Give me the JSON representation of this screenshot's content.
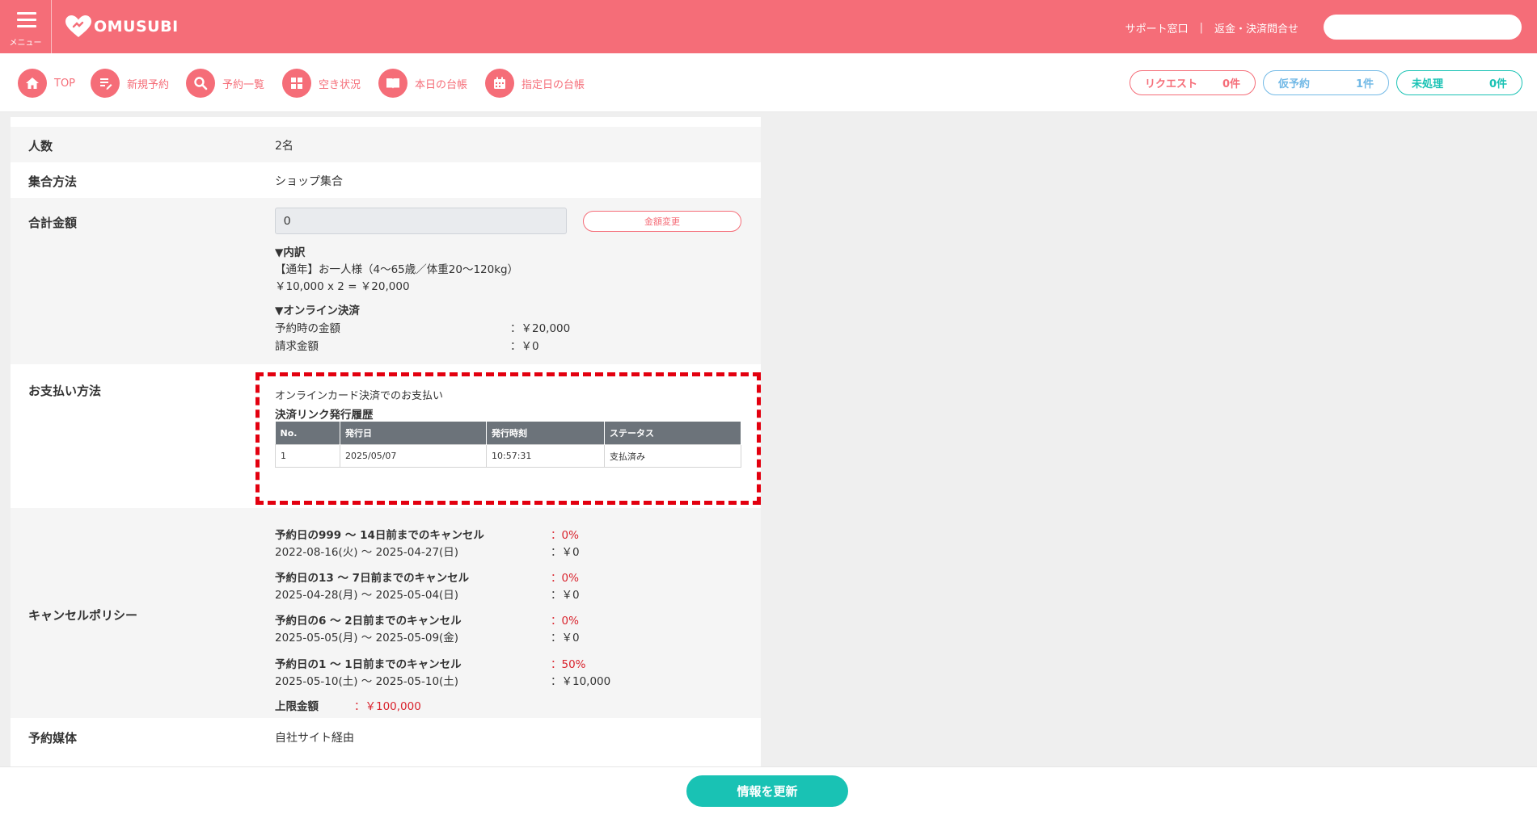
{
  "header": {
    "menu_label": "メニュー",
    "logo_text": "OMUSUBI",
    "support_link": "サポート窓口",
    "separator": "|",
    "refund_link": "返金・決済問合せ",
    "search_placeholder": ""
  },
  "nav": {
    "items": [
      {
        "label": "TOP",
        "icon": "home-icon"
      },
      {
        "label": "新規予約",
        "icon": "new-booking-icon"
      },
      {
        "label": "予約一覧",
        "icon": "search-icon"
      },
      {
        "label": "空き状況",
        "icon": "grid-icon"
      },
      {
        "label": "本日の台帳",
        "icon": "book-icon"
      },
      {
        "label": "指定日の台帳",
        "icon": "calendar-icon"
      }
    ],
    "pills": [
      {
        "label": "リクエスト",
        "count": "0件",
        "color": "#f56d78"
      },
      {
        "label": "仮予約",
        "count": "1件",
        "color": "#72b9e6"
      },
      {
        "label": "未処理",
        "count": "0件",
        "color": "#19c2b4"
      }
    ]
  },
  "form": {
    "people": {
      "label": "人数",
      "value": "2名"
    },
    "meeting": {
      "label": "集合方法",
      "value": "ショップ集合"
    },
    "total": {
      "label": "合計金額",
      "input_value": "0",
      "change_button": "金額変更",
      "breakdown_heading": "▼内訳",
      "breakdown_item": "【通年】お一人様（4〜65歳／体重20〜120kg）",
      "breakdown_calc": "￥10,000 x 2 = ￥20,000",
      "online_heading": "▼オンライン決済",
      "reserve_amount_label": "予約時の金額",
      "reserve_amount_value": "：￥20,000",
      "billing_label": "請求金額",
      "billing_value": "：￥0"
    },
    "payment": {
      "label": "お支払い方法",
      "method": "オンラインカード決済でのお支払い",
      "history_title": "決済リンク発行履歴",
      "columns": [
        "No.",
        "発行日",
        "発行時刻",
        "ステータス"
      ],
      "rows": [
        [
          "1",
          "2025/05/07",
          "10:57:31",
          "支払済み"
        ]
      ]
    },
    "cancel": {
      "label": "キャンセルポリシー",
      "policies": [
        {
          "title": "予約日の999 〜 14日前までのキャンセル",
          "rate": "：0%",
          "period": "2022-08-16(火) 〜 2025-04-27(日)",
          "amount": "：￥0"
        },
        {
          "title": "予約日の13 〜 7日前までのキャンセル",
          "rate": "：0%",
          "period": "2025-04-28(月) 〜 2025-05-04(日)",
          "amount": "：￥0"
        },
        {
          "title": "予約日の6 〜 2日前までのキャンセル",
          "rate": "：0%",
          "period": "2025-05-05(月) 〜 2025-05-09(金)",
          "amount": "：￥0"
        },
        {
          "title": "予約日の1 〜 1日前までのキャンセル",
          "rate": "：50%",
          "period": "2025-05-10(土) 〜 2025-05-10(土)",
          "amount": "：￥10,000"
        }
      ],
      "limit_label": "上限金額",
      "limit_value": "：￥100,000"
    },
    "media": {
      "label": "予約媒体",
      "value": "自社サイト経由"
    }
  },
  "footer": {
    "update_button": "情報を更新"
  },
  "colors": {
    "brand": "#f56d78",
    "teal": "#19c2b4",
    "blue": "#72b9e6",
    "alert": "#e3000f"
  }
}
